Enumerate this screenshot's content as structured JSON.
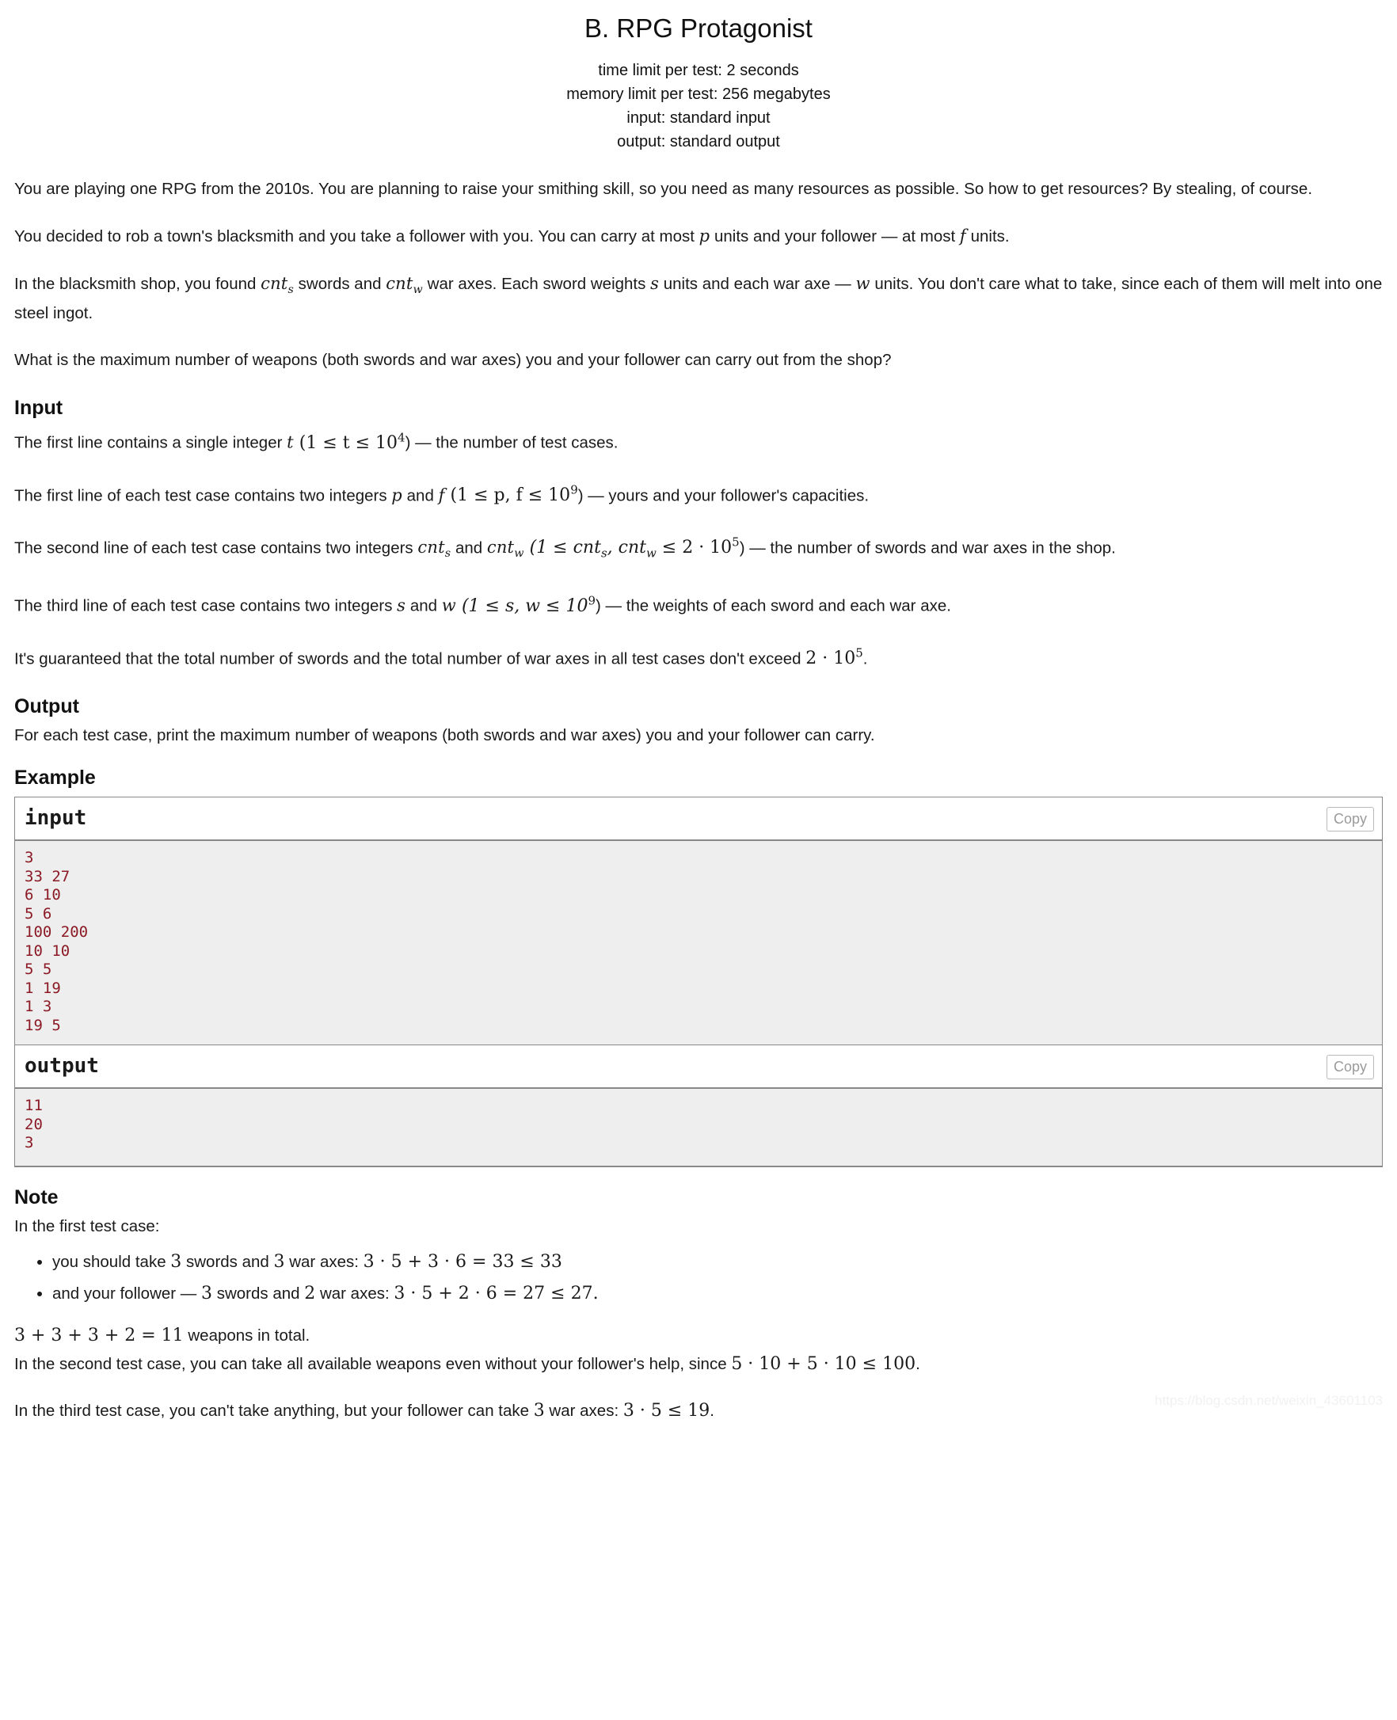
{
  "header": {
    "title": "B. RPG Protagonist",
    "time_limit": "time limit per test: 2 seconds",
    "memory_limit": "memory limit per test: 256 megabytes",
    "input_spec": "input: standard input",
    "output_spec": "output: standard output"
  },
  "legend": {
    "p1": "You are playing one RPG from the 2010s. You are planning to raise your smithing skill, so you need as many resources as possible. So how to get resources? By stealing, of course.",
    "p2_a": "You decided to rob a town's blacksmith and you take a follower with you. You can carry at most ",
    "p2_p": "p",
    "p2_b": " units and your follower — at most ",
    "p2_f": "f",
    "p2_c": " units.",
    "p3_a": "In the blacksmith shop, you found ",
    "p3_cnts": "cnt",
    "p3_cnts_sub": "s",
    "p3_b": " swords and ",
    "p3_cntw": "cnt",
    "p3_cntw_sub": "w",
    "p3_c": " war axes. Each sword weights ",
    "p3_s": "s",
    "p3_d": " units and each war axe — ",
    "p3_w": "w",
    "p3_e": " units. You don't care what to take, since each of them will melt into one steel ingot.",
    "p4": "What is the maximum number of weapons (both swords and war axes) you and your follower can carry out from the shop?"
  },
  "input_section": {
    "heading": "Input",
    "l1_a": "The first line contains a single integer ",
    "l1_t": "t",
    "l1_math": "(1 ≤ t ≤ 10",
    "l1_exp": "4",
    "l1_b": ") — the number of test cases.",
    "l2_a": "The first line of each test case contains two integers ",
    "l2_p": "p",
    "l2_and": " and ",
    "l2_f": "f",
    "l2_math": "(1 ≤ p, f ≤ 10",
    "l2_exp": "9",
    "l2_b": ") — yours and your follower's capacities.",
    "l3_a": "The second line of each test case contains two integers ",
    "l3_cnts": "cnt",
    "l3_cnts_sub": "s",
    "l3_and": " and ",
    "l3_cntw": "cnt",
    "l3_cntw_sub": "w",
    "l3_math_a": "(1 ≤ cnt",
    "l3_math_sub1": "s",
    "l3_math_b": ", cnt",
    "l3_math_sub2": "w",
    "l3_math_c": " ≤ 2 · 10",
    "l3_exp": "5",
    "l3_b": ") — the number of swords and war axes in the shop.",
    "l4_a": "The third line of each test case contains two integers ",
    "l4_s": "s",
    "l4_and": " and ",
    "l4_w": "w",
    "l4_math": "(1 ≤ s, w ≤ 10",
    "l4_exp": "9",
    "l4_b": ") — the weights of each sword and each war axe.",
    "l5_a": "It's guaranteed that the total number of swords and the total number of war axes in all test cases don't exceed ",
    "l5_math": "2 · 10",
    "l5_exp": "5",
    "l5_b": "."
  },
  "output_section": {
    "heading": "Output",
    "text": "For each test case, print the maximum number of weapons (both swords and war axes) you and your follower can carry."
  },
  "example": {
    "heading": "Example",
    "input_label": "input",
    "output_label": "output",
    "copy_label": "Copy",
    "input_text": "3\n33 27\n6 10\n5 6\n100 200\n10 10\n5 5\n1 19\n1 3\n19 5",
    "output_text": "11\n20\n3"
  },
  "note": {
    "heading": "Note",
    "intro": "In the first test case:",
    "bullets": [
      {
        "a": "you should take ",
        "n1": "3",
        "b": " swords and ",
        "n2": "3",
        "c": " war axes: ",
        "math": "3 · 5 + 3 · 6 = 33 ≤ 33"
      },
      {
        "a": "and your follower — ",
        "n1": "3",
        "b": " swords and ",
        "n2": "2",
        "c": " war axes: ",
        "math": "3 · 5 + 2 · 6 = 27 ≤ 27."
      }
    ],
    "total_math": "3 + 3 + 3 + 2 = 11",
    "total_text": " weapons in total.",
    "second_a": "In the second test case, you can take all available weapons even without your follower's help, since ",
    "second_math": "5 · 10 + 5 · 10 ≤ 100",
    "second_b": ".",
    "third_a": "In the third test case, you can't take anything, but your follower can take ",
    "third_n": "3",
    "third_b": " war axes: ",
    "third_math": "3 · 5 ≤ 19",
    "third_c": "."
  },
  "watermark": "https://blog.csdn.net/weixin_43601103"
}
